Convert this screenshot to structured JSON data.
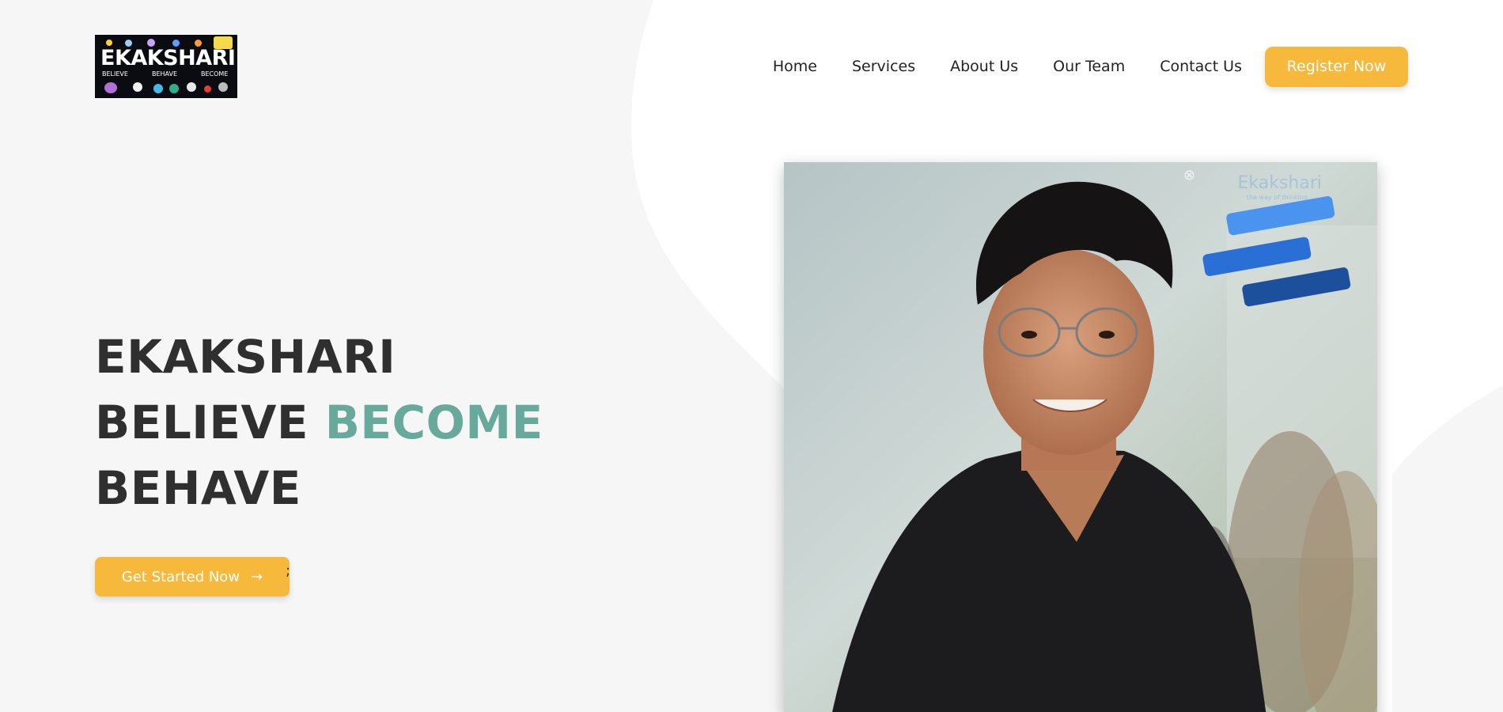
{
  "header": {
    "logo": {
      "title": "EKAKSHARI",
      "taglines": [
        "BELIEVE",
        "BEHAVE",
        "BECOME"
      ]
    },
    "nav": [
      "Home",
      "Services",
      "About Us",
      "Our Team",
      "Contact Us"
    ],
    "register_label": "Register Now"
  },
  "hero": {
    "line1": "EKAKSHARI",
    "line2_a": "BELIEVE",
    "line2_b": "BECOME",
    "line3": "BEHAVE",
    "cta_label": "Get Started Now",
    "cta_icon": "arrow-right-icon",
    "stray_char": ";"
  },
  "photo": {
    "watermark": "Ekakshari",
    "watermark_sub": "the way of thinking"
  },
  "colors": {
    "accent": "#67aa9c",
    "button": "#f6b93b",
    "background_blob": "#f6f6f6",
    "text": "#2f2f2f"
  }
}
